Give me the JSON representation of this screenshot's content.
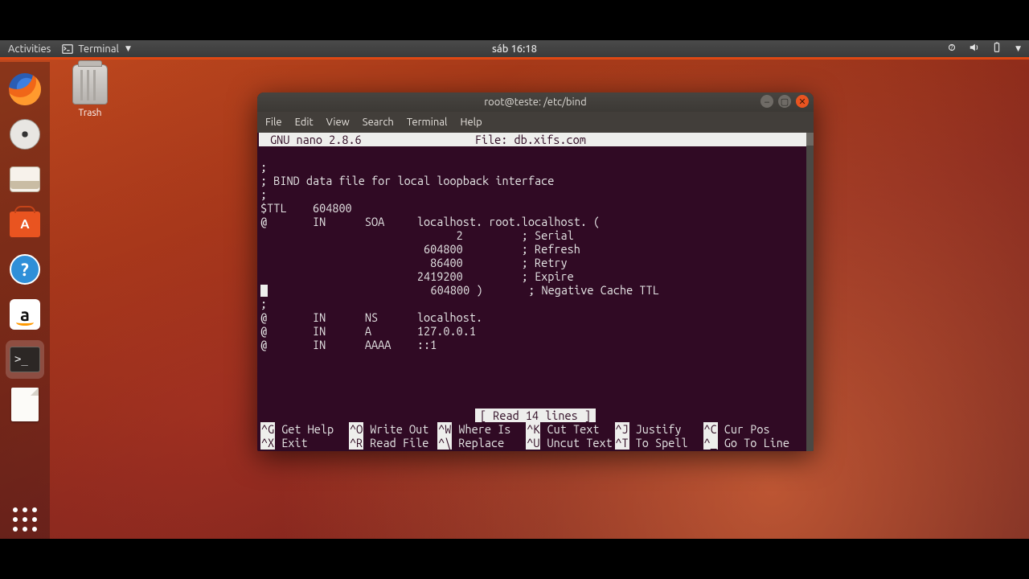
{
  "panel": {
    "activities": "Activities",
    "appmenu": "Terminal",
    "clock": "sáb 16:18"
  },
  "desktop": {
    "trash_label": "Trash"
  },
  "window": {
    "title": "root@teste: /etc/bind",
    "menus": [
      "File",
      "Edit",
      "View",
      "Search",
      "Terminal",
      "Help"
    ]
  },
  "nano": {
    "version": "GNU nano 2.8.6",
    "file_label": "File: db.xifs.com",
    "content_lines": [
      ";",
      "; BIND data file for local loopback interface",
      ";",
      "$TTL    604800",
      "@       IN      SOA     localhost. root.localhost. (",
      "                              2         ; Serial",
      "                         604800         ; Refresh",
      "                          86400         ; Retry",
      "                        2419200         ; Expire",
      "                         604800 )       ; Negative Cache TTL",
      ";",
      "@       IN      NS      localhost.",
      "@       IN      A       127.0.0.1",
      "@       IN      AAAA    ::1"
    ],
    "status": "[ Read 14 lines ]",
    "shortcuts_row1": [
      {
        "k": "^G",
        "l": "Get Help"
      },
      {
        "k": "^O",
        "l": "Write Out"
      },
      {
        "k": "^W",
        "l": "Where Is"
      },
      {
        "k": "^K",
        "l": "Cut Text"
      },
      {
        "k": "^J",
        "l": "Justify"
      },
      {
        "k": "^C",
        "l": "Cur Pos"
      }
    ],
    "shortcuts_row2": [
      {
        "k": "^X",
        "l": "Exit"
      },
      {
        "k": "^R",
        "l": "Read File"
      },
      {
        "k": "^\\",
        "l": "Replace"
      },
      {
        "k": "^U",
        "l": "Uncut Text"
      },
      {
        "k": "^T",
        "l": "To Spell"
      },
      {
        "k": "^_",
        "l": "Go To Line"
      }
    ]
  }
}
